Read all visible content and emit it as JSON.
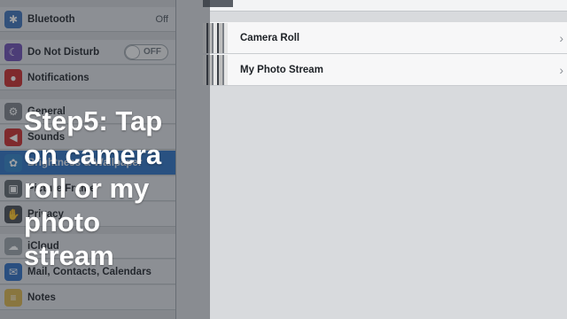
{
  "sidebar": {
    "items": [
      {
        "label": "Bluetooth",
        "value": "Off",
        "icon": "bluetooth-icon",
        "color": "#3b6fb6"
      },
      {
        "label": "Do Not Disturb",
        "toggle": "OFF",
        "icon": "moon-icon",
        "color": "#6b4bb0"
      },
      {
        "label": "Notifications",
        "icon": "notifications-icon",
        "color": "#c62828"
      },
      {
        "label": "General",
        "icon": "gear-icon",
        "color": "#7a7f86"
      },
      {
        "label": "Sounds",
        "icon": "speaker-icon",
        "color": "#c62828"
      },
      {
        "label": "Brightness & Wallpaper",
        "icon": "flower-icon",
        "color": "#2d7ec4"
      },
      {
        "label": "Picture Frame",
        "icon": "frame-icon",
        "color": "#5d646b"
      },
      {
        "label": "Privacy",
        "icon": "hand-icon",
        "color": "#444a50"
      },
      {
        "label": "iCloud",
        "icon": "cloud-icon",
        "color": "#9aa0a6"
      },
      {
        "label": "Mail, Contacts, Calendars",
        "icon": "mail-icon",
        "color": "#2d6cc0"
      },
      {
        "label": "Notes",
        "icon": "notes-icon",
        "color": "#d9b24a"
      }
    ]
  },
  "albums": [
    {
      "label": "Camera Roll"
    },
    {
      "label": "My Photo Stream"
    }
  ],
  "caption": {
    "text": "Step5: Tap on camera roll or my photo stream"
  },
  "icons": {
    "chevron": "chevron-right-icon"
  },
  "colors": {
    "selected_row": "#2a6fc1",
    "overlay_text": "#ffffff"
  }
}
